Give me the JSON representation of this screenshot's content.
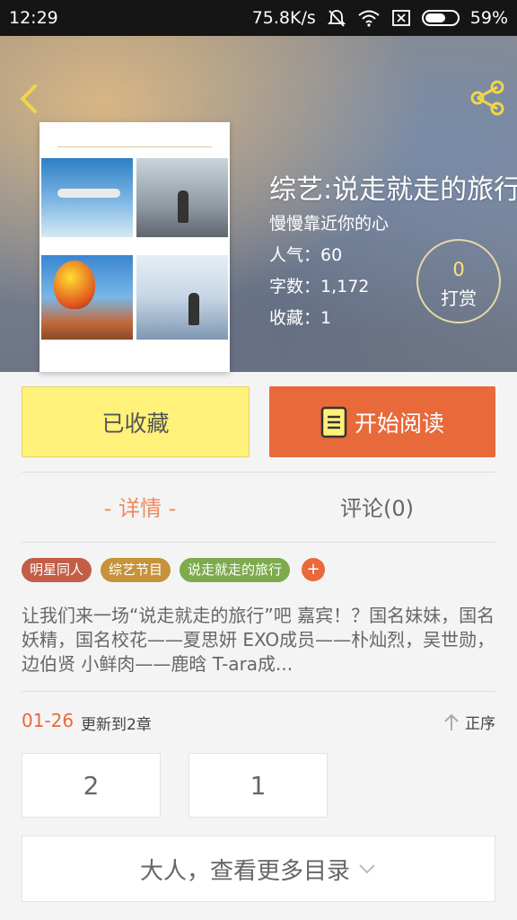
{
  "statusbar": {
    "time": "12:29",
    "speed": "75.8K/s",
    "battery": "59%",
    "battery_level": 0.59,
    "icons": [
      "mute-icon",
      "wifi-icon",
      "sim-off-icon",
      "battery-icon"
    ]
  },
  "book": {
    "title": "综艺:说走就走的旅行",
    "author": "慢慢靠近你的心",
    "popularity": "人气：60",
    "word_count": "字数：1,172",
    "favorites": "收藏：1",
    "tip_count": "0",
    "tip_label": "打赏"
  },
  "actions": {
    "fav_label": "已收藏",
    "read_label": "开始阅读"
  },
  "tabs": {
    "detail": "- 详情 -",
    "comment": "评论(0)"
  },
  "tags": [
    "明星同人",
    "综艺节目",
    "说走就走的旅行"
  ],
  "tag_add": "+",
  "description": "让我们来一场“说走就走的旅行”吧    嘉宾！？国名妹妹，国名妖精，国名校花——夏思妍  EXO成员——朴灿烈，吴世勋，边伯贤  小鲜肉——鹿晗  T-ara成...",
  "update": {
    "date": "01-26",
    "text": "更新到2章",
    "sort_label": "正序"
  },
  "chapters": [
    "2",
    "1"
  ],
  "more_label": "大人，查看更多目录",
  "colors": {
    "accent": "#e8693a",
    "fav_button": "#fff17a",
    "tip_number": "#ffe07a"
  }
}
